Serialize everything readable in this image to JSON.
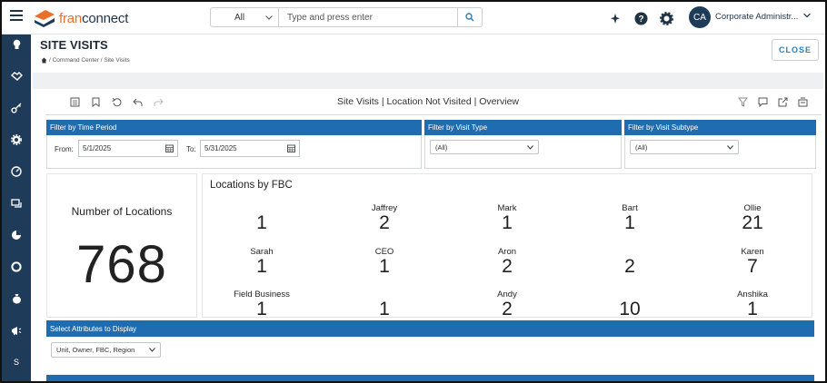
{
  "app": {
    "brand_prefix": "fran",
    "brand_suffix": "connect"
  },
  "search": {
    "scope": "All",
    "placeholder": "Type and press enter"
  },
  "user": {
    "initials": "CA",
    "name": "Corporate Administr..."
  },
  "sidebar": {
    "items": [
      "bulb",
      "handshake",
      "key",
      "gear",
      "gauge",
      "chat",
      "pie",
      "lifebuoy",
      "moneybag",
      "megaphone",
      "S"
    ]
  },
  "page": {
    "title": "SITE VISITS",
    "breadcrumb": "/ Command Center / Site Visits",
    "close_label": "CLOSE"
  },
  "report": {
    "title": "Site Visits | Location Not Visited | Overview"
  },
  "filters": {
    "time_period": {
      "header": "Filter by Time Period",
      "from_label": "From:",
      "from_value": "5/1/2025",
      "to_label": "To:",
      "to_value": "5/31/2025"
    },
    "visit_type": {
      "header": "Filter by Visit Type",
      "value": "(All)"
    },
    "visit_subtype": {
      "header": "Filter by Visit Subtype",
      "value": "(All)"
    }
  },
  "locations": {
    "title": "Number of Locations",
    "value": "768"
  },
  "fbc": {
    "title": "Locations by FBC",
    "cells": [
      {
        "name": "",
        "value": "1"
      },
      {
        "name": "Jaffrey",
        "value": "2"
      },
      {
        "name": "Mark",
        "value": "1"
      },
      {
        "name": "Bart",
        "value": "1"
      },
      {
        "name": "Ollie",
        "value": "21"
      },
      {
        "name": "Sarah",
        "value": "1"
      },
      {
        "name": "CEO",
        "value": "1"
      },
      {
        "name": "Aron",
        "value": "2"
      },
      {
        "name": "",
        "value": "2"
      },
      {
        "name": "Karen",
        "value": "7"
      },
      {
        "name": "Field Business",
        "value": "1"
      },
      {
        "name": "",
        "value": "1"
      },
      {
        "name": "Andy",
        "value": "2"
      },
      {
        "name": "",
        "value": "10"
      },
      {
        "name": "Anshika",
        "value": "1"
      }
    ]
  },
  "attributes": {
    "header": "Select Attributes to Display",
    "value": "Unit, Owner, FBC, Region"
  }
}
